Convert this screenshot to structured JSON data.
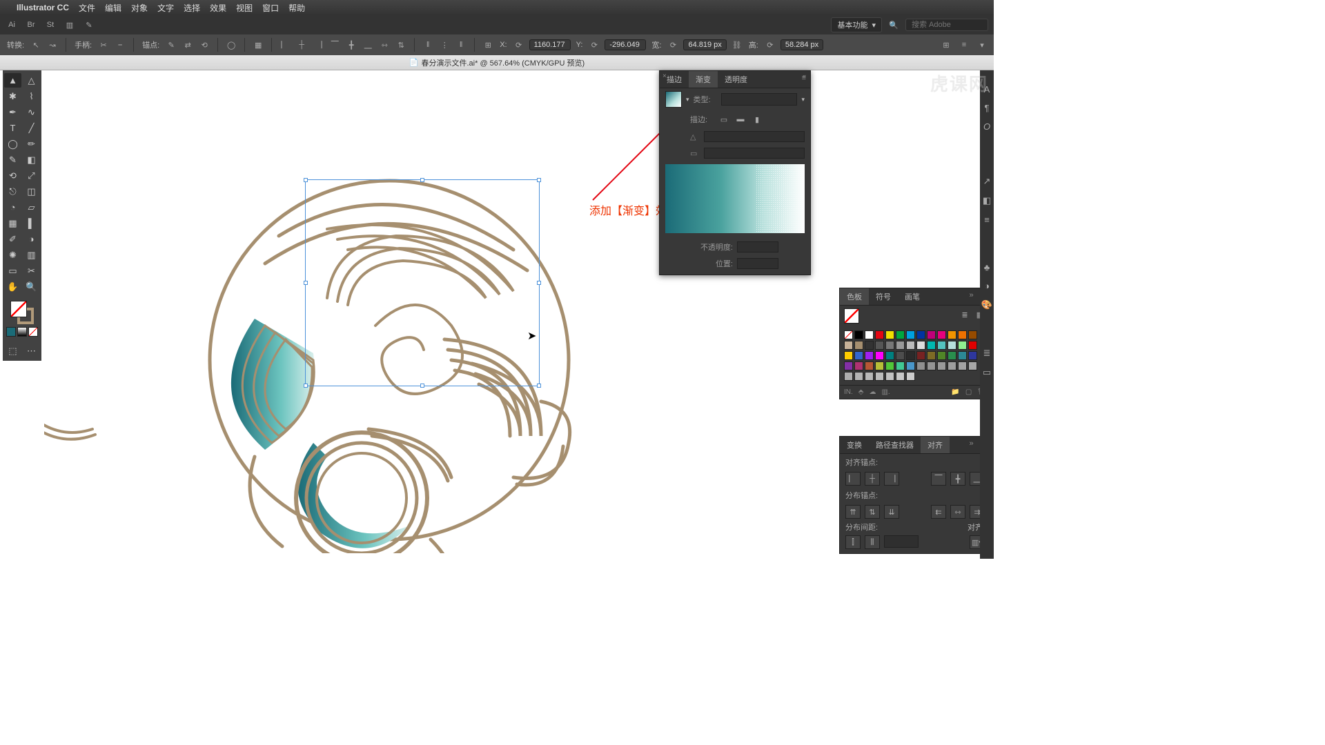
{
  "menubar": {
    "app": "Illustrator CC",
    "items": [
      "文件",
      "编辑",
      "对象",
      "文字",
      "选择",
      "效果",
      "视图",
      "窗口",
      "帮助"
    ]
  },
  "apptop": {
    "essentials": "基本功能",
    "search_placeholder": "搜索 Adobe"
  },
  "controlbar": {
    "transform_label": "转换:",
    "handle_label": "手柄:",
    "anchor_label": "锚点:",
    "x_label": "X:",
    "x_value": "1160.177",
    "y_label": "Y:",
    "y_value": "-296.049",
    "w_label": "宽:",
    "w_value": "64.819 px",
    "h_label": "高:",
    "h_value": "58.284 px"
  },
  "doc": {
    "title": "春分演示文件.ai* @ 567.64% (CMYK/GPU 预览)"
  },
  "annotation": {
    "text": "添加【渐变】效果"
  },
  "gradient_panel": {
    "tab_stroke": "描边",
    "tab_gradient": "渐变",
    "tab_opacity": "透明度",
    "type_label": "类型:",
    "stroke_label": "描边:",
    "opacity_label": "不透明度:",
    "position_label": "位置:"
  },
  "swatches_panel": {
    "tab_swatches": "色板",
    "tab_symbols": "符号",
    "tab_brushes": "画笔"
  },
  "align_panel": {
    "tab_transform": "变换",
    "tab_pathfinder": "路径查找器",
    "tab_align": "对齐",
    "sec_align": "对齐锚点:",
    "sec_distribute": "分布锚点:",
    "sec_spacing": "分布间距:",
    "align_to": "对齐:"
  },
  "swatch_colors": [
    "#ffffff00",
    "#000000",
    "#ffffff",
    "#e30613",
    "#f0e000",
    "#00a63f",
    "#00a2e0",
    "#0033a0",
    "#c0007a",
    "#e6007e",
    "#f29400",
    "#ee7100",
    "#964b00",
    "#c7b299",
    "#a68f6f",
    "#333333",
    "#555555",
    "#777777",
    "#999999",
    "#bbbbbb",
    "#dddddd",
    "#00b8b0",
    "#54c2bf",
    "#b7e0dc",
    "#90ee90",
    "#e10000",
    "#ffcc00",
    "#3366cc",
    "#a020f0",
    "#ff00ff",
    "#008080",
    "#4d4d4d",
    "#2b2b2b"
  ],
  "watermark": "虎课网"
}
